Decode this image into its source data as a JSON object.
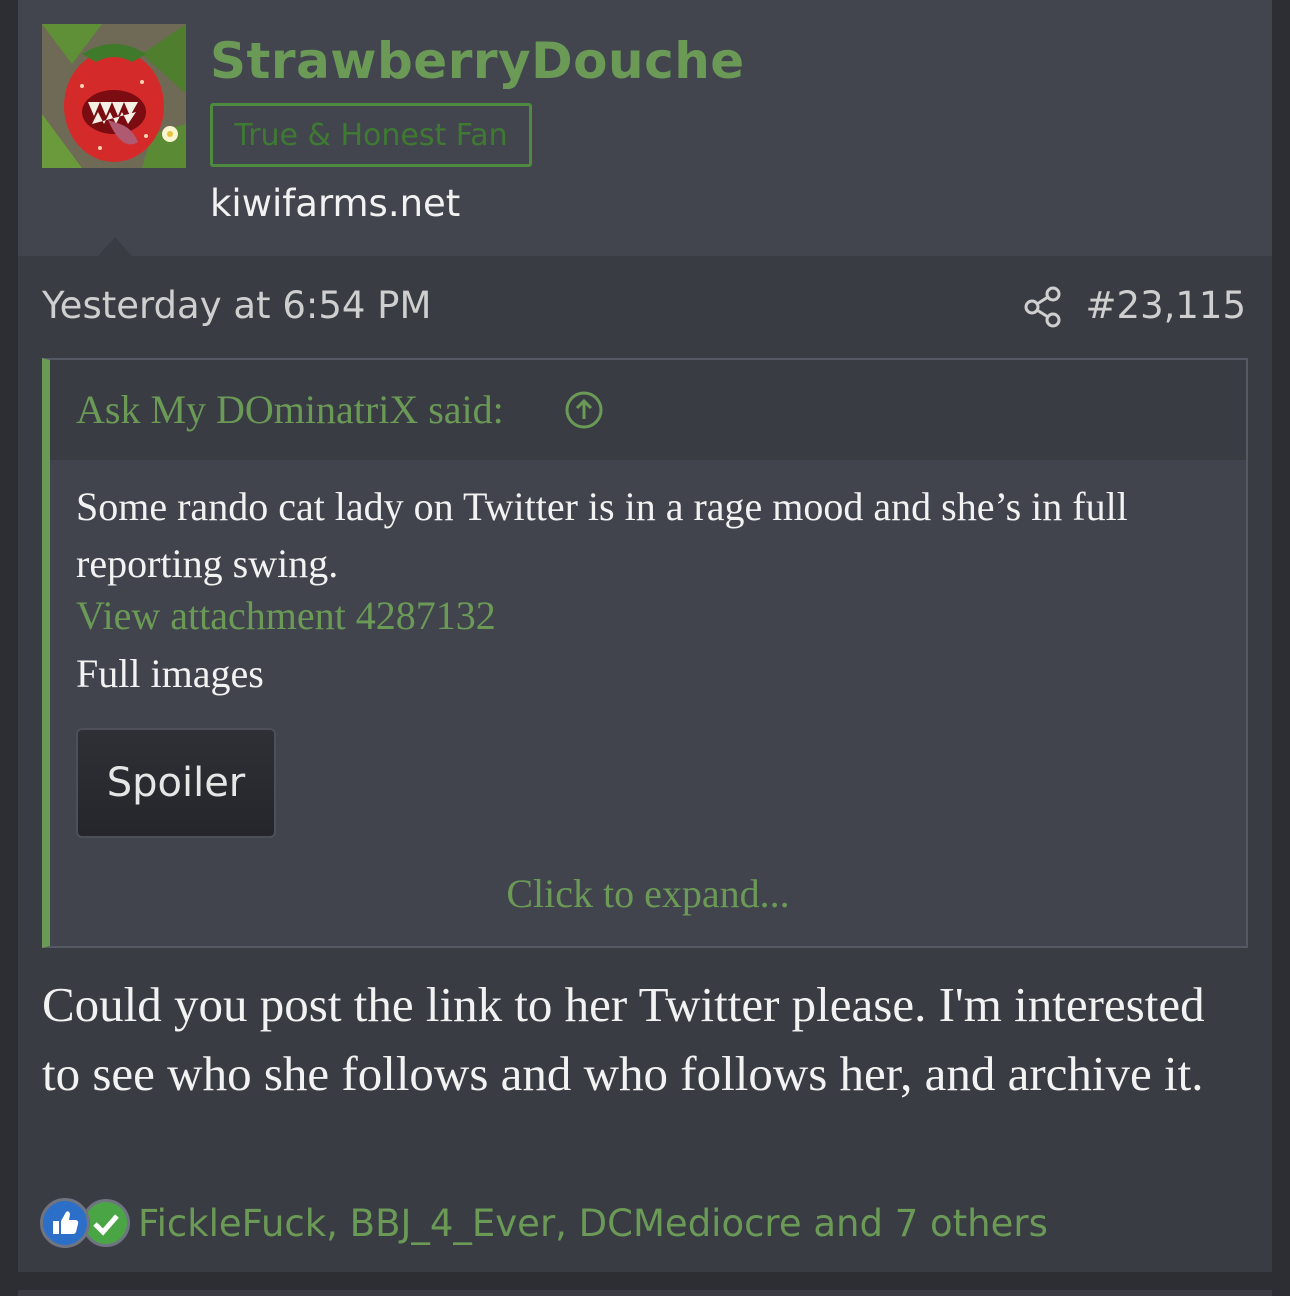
{
  "user": {
    "name": "StrawberryDouche",
    "title": "True & Honest Fan",
    "site": "kiwifarms.net",
    "avatar_icon": "strawberry-monster-avatar"
  },
  "post": {
    "date": "Yesterday at 6:54 PM",
    "number": "#23,115",
    "share_icon": "share-icon"
  },
  "quote": {
    "author": "Ask My DOminatriX said:",
    "jump_icon": "arrow-up-circle-icon",
    "text": "Some rando cat lady on Twitter is in a rage mood and she’s in full reporting swing.",
    "attachment_link": "View attachment 4287132",
    "extra_line": "Full images",
    "spoiler_label": "Spoiler",
    "expand_label": "Click to expand..."
  },
  "body": {
    "text": "Could you post the link to her Twitter please. I'm interested to see who she follows and who follows her, and archive it."
  },
  "reactions": {
    "icons": [
      "thumbs-up-icon",
      "checkmark-icon"
    ],
    "names": "FickleFuck, BBJ_4_Ever, DCMediocre and 7 others"
  },
  "colors": {
    "accent": "#6b9a57",
    "background": "#393c43",
    "header_bg": "#42454d",
    "like_blue": "#2c6fc9",
    "agree_green": "#4aa645"
  }
}
